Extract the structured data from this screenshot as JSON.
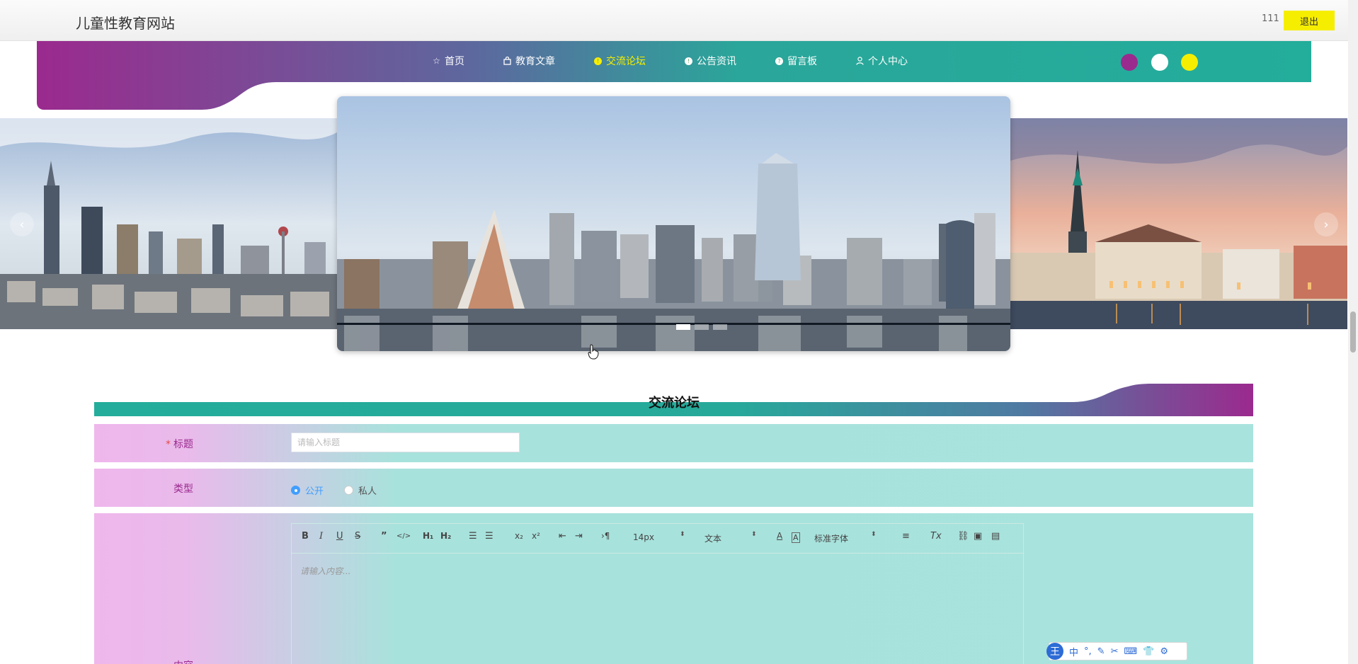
{
  "header": {
    "site_title": "儿童性教育网站",
    "user_name": "111",
    "logout_label": "退出"
  },
  "nav": {
    "items": [
      {
        "label": "首页",
        "icon": "star-icon"
      },
      {
        "label": "教育文章",
        "icon": "bag-icon"
      },
      {
        "label": "交流论坛",
        "icon": "info-icon"
      },
      {
        "label": "公告资讯",
        "icon": "info-icon"
      },
      {
        "label": "留言板",
        "icon": "info-icon"
      },
      {
        "label": "个人中心",
        "icon": "user-icon"
      }
    ],
    "active_index": 2,
    "theme_colors": [
      "#9b2a8e",
      "#ffffff",
      "#f6ee00"
    ]
  },
  "carousel": {
    "active_slide": 1,
    "slide_count": 3,
    "prev_icon": "‹",
    "next_icon": "›"
  },
  "section": {
    "title": "交流论坛"
  },
  "form": {
    "title_label": "标题",
    "title_placeholder": "请输入标题",
    "type_label": "类型",
    "type_options": [
      "公开",
      "私人"
    ],
    "type_selected": "公开",
    "content_label": "内容",
    "editor": {
      "font_size": "14px",
      "heading": "文本",
      "font_family": "标准字体",
      "placeholder": "请输入内容..."
    }
  },
  "colors": {
    "purple": "#9b2a8e",
    "teal": "#26ad9b",
    "yellow": "#f6ee00"
  }
}
